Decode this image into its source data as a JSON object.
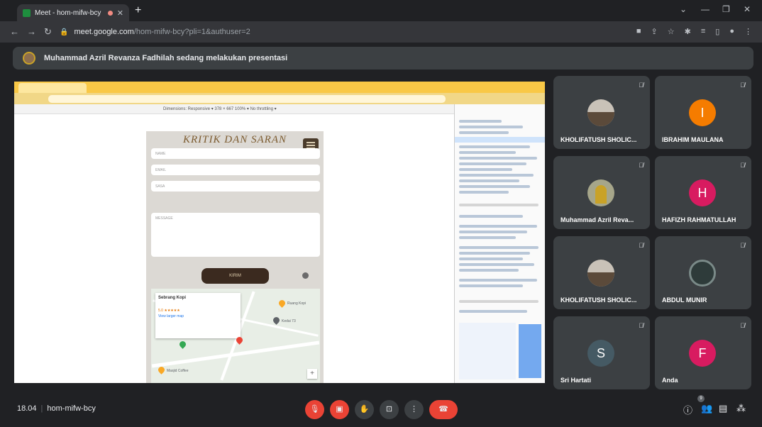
{
  "browser": {
    "tab_title": "Meet - hom-mifw-bcy",
    "new_tab": "+",
    "url_host": "meet.google.com",
    "url_path": "/hom-mifw-bcy?pli=1&authuser=2"
  },
  "banner": {
    "text": "Muhammad Azril Revanza Fadhilah sedang melakukan presentasi"
  },
  "shared_screen": {
    "devbar_text": "Dimensions: Responsive ▾   378  ×  667    100% ▾   No throttling ▾",
    "page": {
      "title": "KRITIK DAN SARAN",
      "field_name": "NAME",
      "field_email": "EMAIL",
      "field_select": "SASA",
      "field_message": "MESSAGE",
      "submit": "KIRIM"
    },
    "map": {
      "place_name": "Sebrang Kopi",
      "rating": "5.0 ★★★★★",
      "view_larger": "View larger map",
      "label_market": "Ruang Kopi",
      "label_kedai": "Kedai 73",
      "label_coffee": "Masjid Coffee"
    }
  },
  "participants": [
    {
      "name": "KHOLIFATUSH SHOLIC...",
      "initial": "",
      "color": "",
      "type": "photo"
    },
    {
      "name": "IBRAHIM MAULANA",
      "initial": "I",
      "color": "#f57c00",
      "type": "letter"
    },
    {
      "name": "Muhammad Azril Reva...",
      "initial": "",
      "color": "",
      "type": "photo"
    },
    {
      "name": "HAFIZH RAHMATULLAH",
      "initial": "H",
      "color": "#d81b60",
      "type": "letter"
    },
    {
      "name": "KHOLIFATUSH SHOLIC...",
      "initial": "",
      "color": "",
      "type": "photo"
    },
    {
      "name": "ABDUL MUNIR",
      "initial": "",
      "color": "",
      "type": "photo"
    },
    {
      "name": "Sri Hartati",
      "initial": "S",
      "color": "#455a64",
      "type": "letter"
    },
    {
      "name": "Anda",
      "initial": "F",
      "color": "#d81b60",
      "type": "letter"
    }
  ],
  "footer": {
    "time": "18.04",
    "separator": "|",
    "meeting_code": "hom-mifw-bcy",
    "people_count": "9"
  },
  "colors": {
    "end_call": "#ea4335",
    "muted": "#ea4335",
    "tile_bg": "#3c4043"
  }
}
